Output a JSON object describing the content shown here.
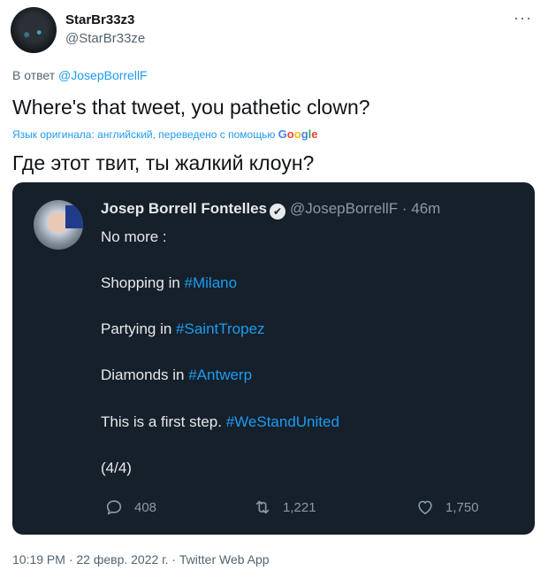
{
  "header": {
    "user_name": "StarBr33z3",
    "user_handle": "@StarBr33ze",
    "more_label": "···"
  },
  "reply": {
    "prefix": "В ответ ",
    "mention": "@JosepBorrellF"
  },
  "tweet": {
    "text": "Where's that tweet, you pathetic clown?",
    "translate_note": "Язык оригинала: английский, переведено с помощью ",
    "translated_text": "Где этот твит, ты жалкий клоун?"
  },
  "google": {
    "letters": [
      "G",
      "o",
      "o",
      "g",
      "l",
      "e"
    ],
    "colors": [
      "#4285f4",
      "#ea4335",
      "#fbbc05",
      "#4285f4",
      "#34a853",
      "#ea4335"
    ]
  },
  "embed": {
    "author_name": "Josep Borrell Fontelles",
    "verified_glyph": "✔",
    "handle": "@JosepBorrellF",
    "dot": " · ",
    "time": "46m",
    "lines": {
      "l1": "No more :",
      "l2_text": "Shopping in ",
      "l2_tag": "#Milano",
      "l3_text": "Partying in ",
      "l3_tag": "#SaintTropez",
      "l4_text": "Diamonds in ",
      "l4_tag": "#Antwerp",
      "l5_text": "This is a first step. ",
      "l5_tag": "#WeStandUnited",
      "l6": "(4/4)"
    },
    "stats": {
      "replies": "408",
      "retweets": "1,221",
      "likes": "1,750"
    },
    "bg_color": "#15202b",
    "hashtag_color": "#1d9bf0"
  },
  "footer": {
    "timestamp": "10:19 PM · 22 февр. 2022 г. · Twitter Web App"
  }
}
